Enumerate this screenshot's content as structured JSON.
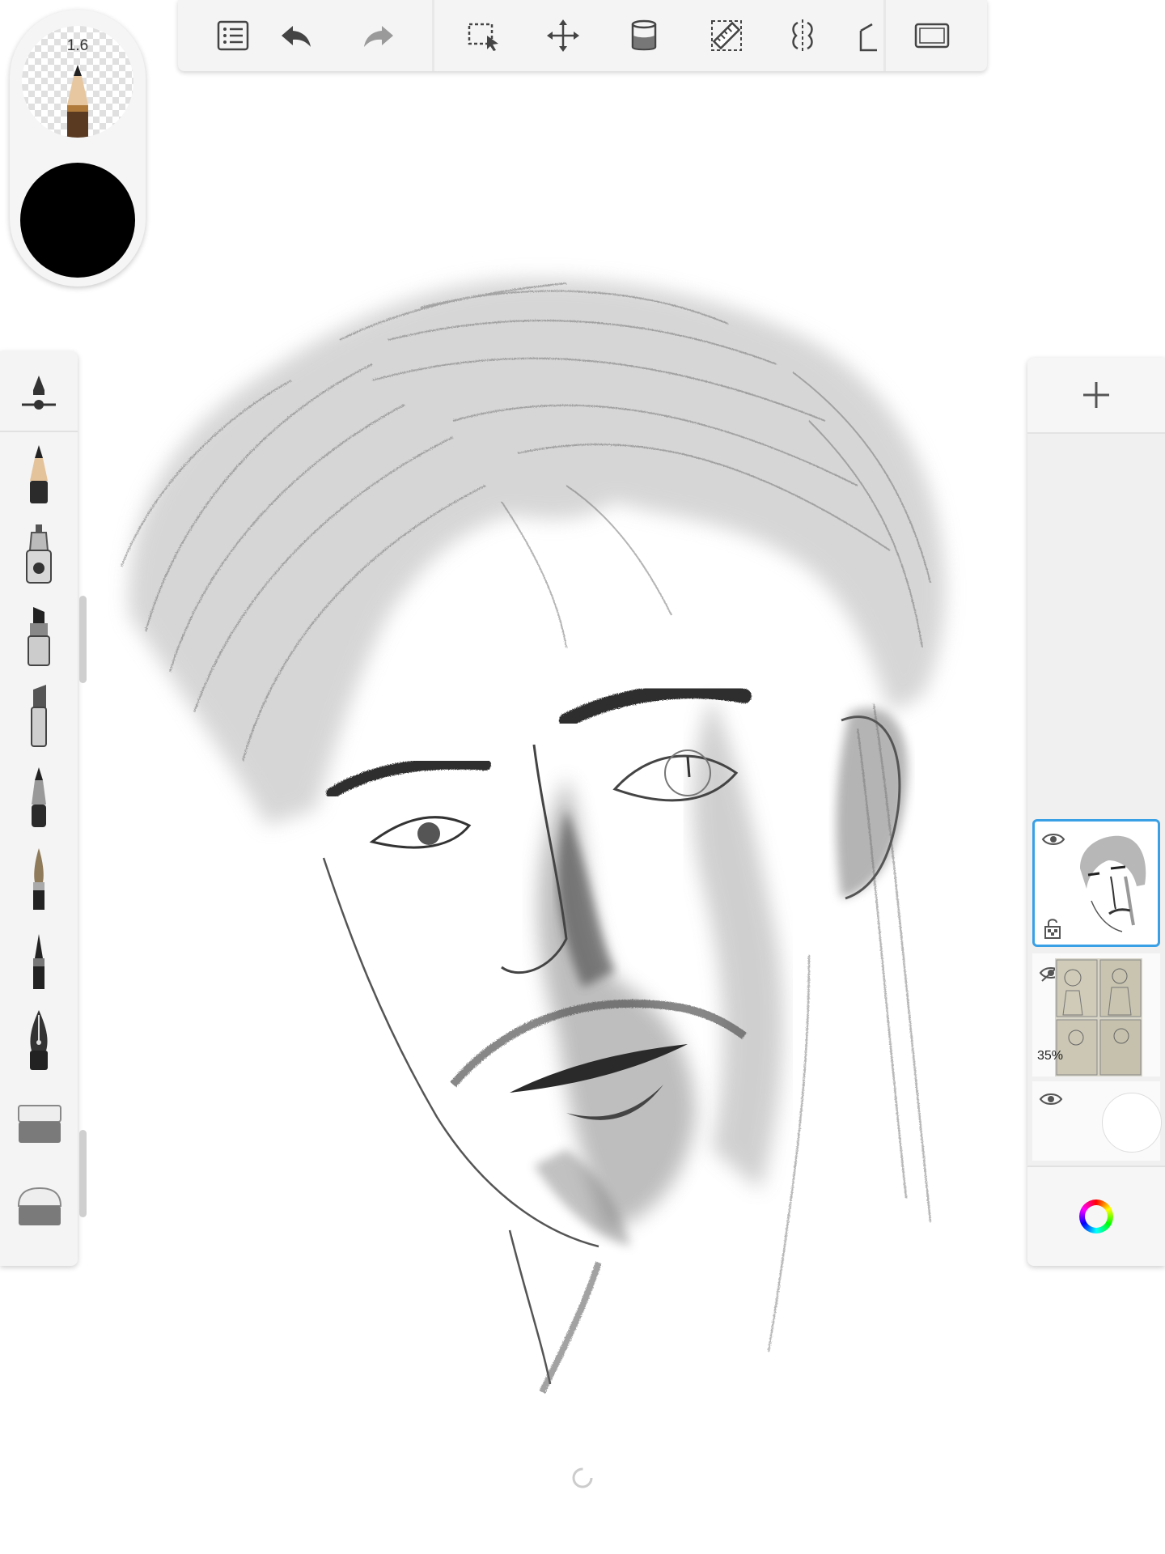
{
  "toolbar": {
    "icons": [
      "list-icon",
      "undo-icon",
      "redo-icon",
      "selection-icon",
      "transform-icon",
      "fill-icon",
      "ruler-icon",
      "symmetry-icon",
      "perspective-icon",
      "fullscreen-icon"
    ]
  },
  "brush_puck": {
    "size_label": "1.6",
    "color": "#000000"
  },
  "brush_palette": {
    "icons": [
      "brush-settings-icon",
      "pencil-icon",
      "airbrush-icon",
      "marker-icon",
      "chisel-marker-icon",
      "ballpoint-pen-icon",
      "paintbrush-icon",
      "ink-pen-icon",
      "fountain-pen-icon",
      "hard-eraser-icon",
      "soft-eraser-icon"
    ]
  },
  "layers": {
    "items": [
      {
        "name": "sketch-layer",
        "visible": true,
        "active": true,
        "opacity_label": ""
      },
      {
        "name": "reference-layer",
        "visible": false,
        "active": false,
        "opacity_label": "35%"
      },
      {
        "name": "background-layer",
        "visible": true,
        "active": false,
        "opacity_label": ""
      }
    ]
  },
  "colors": {
    "accent": "#3aa0e6",
    "toolbar_bg": "#f4f4f4"
  }
}
